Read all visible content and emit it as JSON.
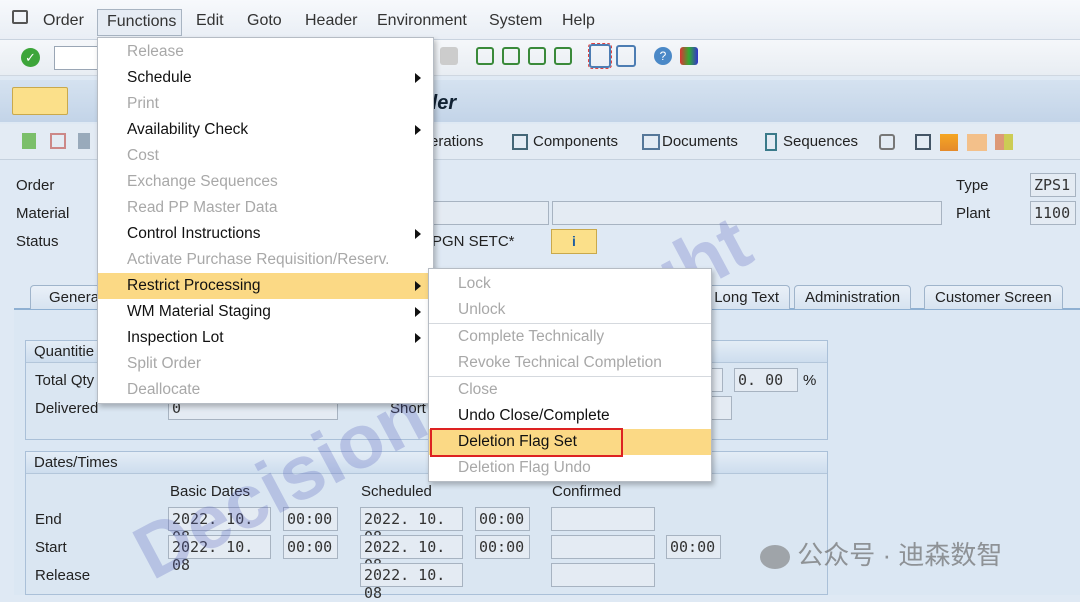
{
  "menubar": {
    "items": [
      "Order",
      "Functions",
      "Edit",
      "Goto",
      "Header",
      "Environment",
      "System",
      "Help"
    ]
  },
  "title": "der",
  "app_toolbar": {
    "operations": "erations",
    "components": "Components",
    "documents": "Documents",
    "sequences": "Sequences"
  },
  "header": {
    "order_label": "Order",
    "material_label": "Material",
    "status_label": "Status",
    "status_value": "PGN SETC*",
    "type_label": "Type",
    "type_value": "ZPS1",
    "plant_label": "Plant",
    "plant_value": "1100"
  },
  "tabs": [
    "Genera",
    "Long Text",
    "Administration",
    "Customer Screen"
  ],
  "quantities": {
    "title": "Quantitie",
    "total_qty_label": "Total Qty",
    "delivered_label": "Delivered",
    "delivered_value": "0",
    "short_label": "Short",
    "pct_value": "0. 00",
    "pct_unit": "%"
  },
  "dates": {
    "title": "Dates/Times",
    "col_basic": "Basic Dates",
    "col_scheduled": "Scheduled",
    "col_confirmed": "Confirmed",
    "end": {
      "label": "End",
      "basic_date": "2022. 10. 08",
      "basic_time": "00:00",
      "sched_date": "2022. 10. 08",
      "sched_time": "00:00"
    },
    "start": {
      "label": "Start",
      "basic_date": "2022. 10. 08",
      "basic_time": "00:00",
      "sched_date": "2022. 10. 08",
      "sched_time": "00:00",
      "conf_time": "00:00"
    },
    "release": {
      "label": "Release",
      "sched_date": "2022. 10. 08"
    }
  },
  "functions_menu": [
    {
      "label": "Release",
      "disabled": true
    },
    {
      "label": "Schedule",
      "submenu": true
    },
    {
      "label": "Print",
      "disabled": true
    },
    {
      "label": "Availability Check",
      "submenu": true
    },
    {
      "label": "Cost",
      "disabled": true
    },
    {
      "label": "Exchange Sequences",
      "disabled": true
    },
    {
      "label": "Read PP Master Data",
      "disabled": true
    },
    {
      "label": "Control Instructions",
      "submenu": true
    },
    {
      "label": "Activate Purchase Requisition/Reserv.",
      "disabled": true
    },
    {
      "label": "Restrict Processing",
      "submenu": true,
      "highlighted": true
    },
    {
      "label": "WM Material Staging",
      "submenu": true
    },
    {
      "label": "Inspection Lot",
      "submenu": true
    },
    {
      "label": "Split Order",
      "disabled": true
    },
    {
      "label": "Deallocate",
      "disabled": true
    }
  ],
  "restrict_submenu": [
    {
      "label": "Lock",
      "disabled": true
    },
    {
      "label": "Unlock",
      "disabled": true
    },
    {
      "separator": true
    },
    {
      "label": "Complete Technically",
      "disabled": true
    },
    {
      "label": "Revoke Technical Completion",
      "disabled": true
    },
    {
      "separator": true
    },
    {
      "label": "Close",
      "disabled": true
    },
    {
      "label": "Undo Close/Complete"
    },
    {
      "label": "Deletion Flag Set",
      "highlighted": true
    },
    {
      "label": "Deletion Flag Undo",
      "disabled": true
    }
  ],
  "watermark": "Decision copyright",
  "wechat_watermark": "公众号 · 迪森数智",
  "colors": {
    "highlight": "#fbd985",
    "callout": "#d22222"
  }
}
